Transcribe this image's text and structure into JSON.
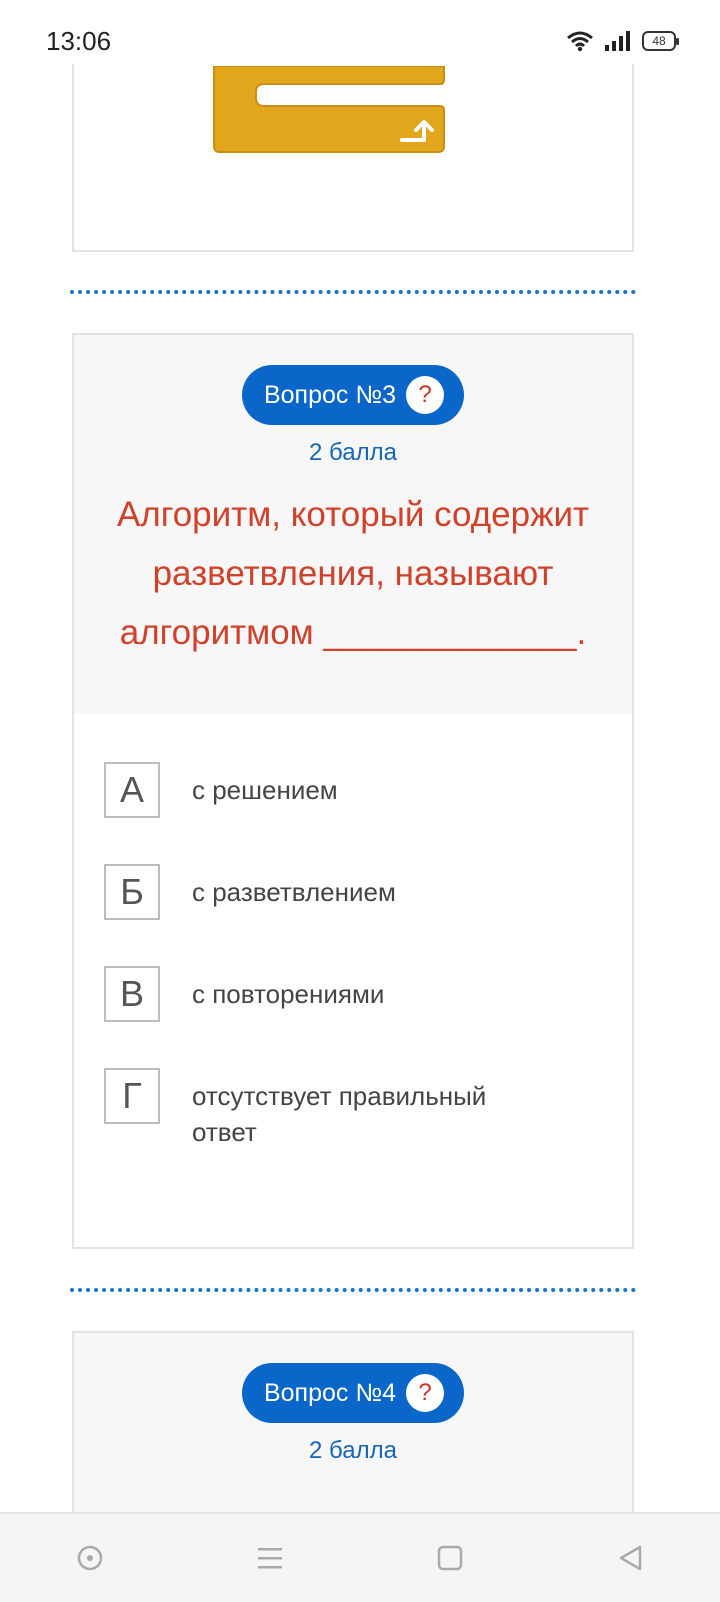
{
  "status": {
    "time": "13:06",
    "battery": "48"
  },
  "questions": [
    {
      "label": "Вопрос №3",
      "help": "?",
      "points": "2 балла",
      "text": "Алгоритм, который содержит разветвления, называют алгоритмом _____________.",
      "answers": [
        {
          "letter": "А",
          "text": "с решением"
        },
        {
          "letter": "Б",
          "text": "с разветвлением"
        },
        {
          "letter": "В",
          "text": "с повторениями"
        },
        {
          "letter": "Г",
          "text": "отсутствует правильный ответ"
        }
      ]
    },
    {
      "label": "Вопрос №4",
      "help": "?",
      "points": "2 балла"
    }
  ],
  "colors": {
    "accent": "#0a66c9",
    "question_text": "#d2402a",
    "block": "#e2a61c"
  },
  "icons": [
    "wifi-icon",
    "signal-icon",
    "battery-icon",
    "circle-nav-icon",
    "menu-nav-icon",
    "home-nav-icon",
    "back-nav-icon"
  ]
}
